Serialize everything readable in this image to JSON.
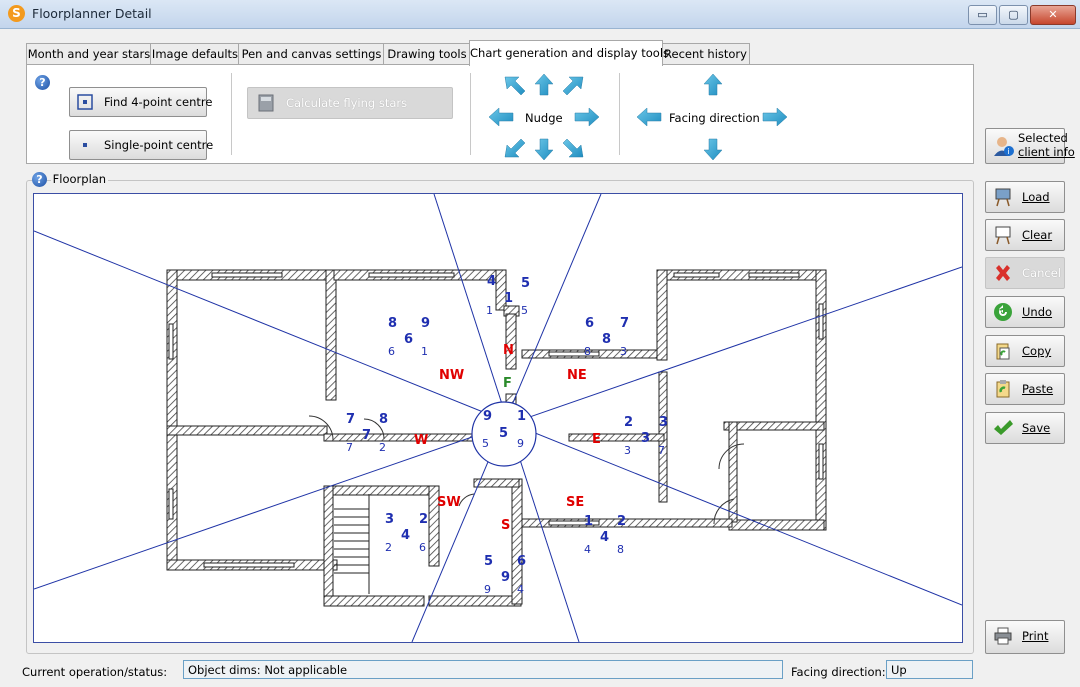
{
  "window": {
    "title": "Floorplanner Detail",
    "app_icon": "S",
    "min": "▭",
    "max": "▢",
    "close": "✕"
  },
  "tabs": [
    {
      "label": "Month and year stars"
    },
    {
      "label": "Image defaults"
    },
    {
      "label": "Pen and canvas settings"
    },
    {
      "label": "Drawing tools"
    },
    {
      "label": "Chart generation and display tools",
      "active": true
    },
    {
      "label": "Recent history"
    }
  ],
  "toolbar": {
    "find_centre": "Find 4-point centre",
    "single_centre": "Single-point centre",
    "calculate_stars": "Calculate flying stars",
    "nudge": "Nudge",
    "facing_direction": "Facing direction"
  },
  "selected_client": {
    "line1": "Selected",
    "line2": "client info"
  },
  "floorplan": {
    "title": "Floorplan",
    "sectors": {
      "NW": "NW",
      "N": "N",
      "NE": "NE",
      "W": "W",
      "E": "E",
      "SW": "SW",
      "S": "S",
      "SE": "SE",
      "F": "F"
    },
    "centre": {
      "tl": "9",
      "tr": "1",
      "c": "5",
      "bl": "5",
      "br": "9"
    },
    "stars": [
      {
        "id": "nw1",
        "t": "8"
      },
      {
        "id": "nw2",
        "t": "9"
      },
      {
        "id": "nw3",
        "t": "6"
      },
      {
        "id": "nw4",
        "t": "6"
      },
      {
        "id": "nw5",
        "t": "1"
      },
      {
        "id": "n1",
        "t": "4"
      },
      {
        "id": "n2",
        "t": "5"
      },
      {
        "id": "n3",
        "t": "1"
      },
      {
        "id": "n4",
        "t": "1"
      },
      {
        "id": "n5",
        "t": "5"
      },
      {
        "id": "ne1",
        "t": "6"
      },
      {
        "id": "ne2",
        "t": "7"
      },
      {
        "id": "ne3",
        "t": "8"
      },
      {
        "id": "ne4",
        "t": "8"
      },
      {
        "id": "ne5",
        "t": "3"
      },
      {
        "id": "w1",
        "t": "7"
      },
      {
        "id": "w2",
        "t": "8"
      },
      {
        "id": "w3",
        "t": "7"
      },
      {
        "id": "w4",
        "t": "7"
      },
      {
        "id": "w5",
        "t": "2"
      },
      {
        "id": "e1",
        "t": "2"
      },
      {
        "id": "e2",
        "t": "3"
      },
      {
        "id": "e3",
        "t": "3"
      },
      {
        "id": "e4",
        "t": "3"
      },
      {
        "id": "e5",
        "t": "7"
      },
      {
        "id": "sw1",
        "t": "3"
      },
      {
        "id": "sw2",
        "t": "2"
      },
      {
        "id": "sw3",
        "t": "4"
      },
      {
        "id": "sw4",
        "t": "2"
      },
      {
        "id": "sw5",
        "t": "6"
      },
      {
        "id": "s1",
        "t": "5"
      },
      {
        "id": "s2",
        "t": "6"
      },
      {
        "id": "s3",
        "t": "9"
      },
      {
        "id": "s4",
        "t": "9"
      },
      {
        "id": "s5",
        "t": "4"
      },
      {
        "id": "se1",
        "t": "1"
      },
      {
        "id": "se2",
        "t": "2"
      },
      {
        "id": "se3",
        "t": "4"
      },
      {
        "id": "se4",
        "t": "4"
      },
      {
        "id": "se5",
        "t": "8"
      }
    ]
  },
  "side_buttons": [
    {
      "label": "Load",
      "icon": "easel-icon"
    },
    {
      "label": "Clear",
      "icon": "blank-easel-icon"
    },
    {
      "label": "Cancel",
      "icon": "red-x-icon",
      "disabled": true
    },
    {
      "label": "Undo",
      "icon": "undo-icon"
    },
    {
      "label": "Copy",
      "icon": "copy-icon"
    },
    {
      "label": "Paste",
      "icon": "paste-icon"
    },
    {
      "label": "Save",
      "icon": "checkmark-icon"
    }
  ],
  "print_label": "Print",
  "status": {
    "operation_label": "Current operation/status:",
    "operation_value": "Object dims: Not applicable",
    "facing_label": "Facing direction:",
    "facing_value": "Up"
  }
}
